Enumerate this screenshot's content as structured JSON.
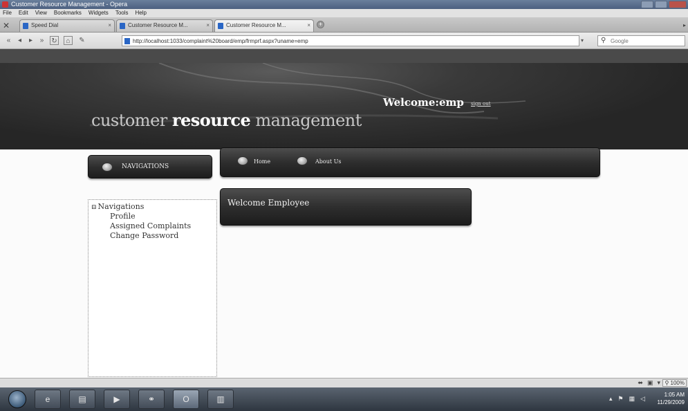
{
  "window": {
    "title": "Customer Resource Management - Opera"
  },
  "menubar": {
    "items": [
      "File",
      "Edit",
      "View",
      "Bookmarks",
      "Widgets",
      "Tools",
      "Help"
    ]
  },
  "tabs": [
    {
      "label": "Speed Dial"
    },
    {
      "label": "Customer Resource M..."
    },
    {
      "label": "Customer Resource M..."
    }
  ],
  "address": {
    "url": "http://localhost:1033/complaint%20board/emp/frmprf.aspx?uname=emp",
    "search_placeholder": "Google"
  },
  "header": {
    "title_part1": "customer ",
    "title_part2": "resource",
    "title_part3": " management",
    "welcome_label": "Welcome:",
    "welcome_user": "emp",
    "signout": "sign out"
  },
  "nav": {
    "header": "NAVIGATIONS",
    "menu": [
      {
        "label": "Home"
      },
      {
        "label": "About Us"
      }
    ],
    "tree": {
      "root": "Navigations",
      "items": [
        "Profile",
        "Assigned Complaints",
        "Change Password"
      ]
    }
  },
  "content": {
    "welcome": "Welcome Employee"
  },
  "statusbar": {
    "zoom": "100%"
  },
  "taskbar": {
    "time": "1:05 AM",
    "date": "11/29/2009"
  },
  "colors": {
    "banner": "#2e2e2e",
    "panel_dark": "#1c1c1c",
    "taskbar": "#3a434e"
  },
  "icons": {
    "search": "magnifier-icon",
    "start": "windows-orb-icon"
  }
}
